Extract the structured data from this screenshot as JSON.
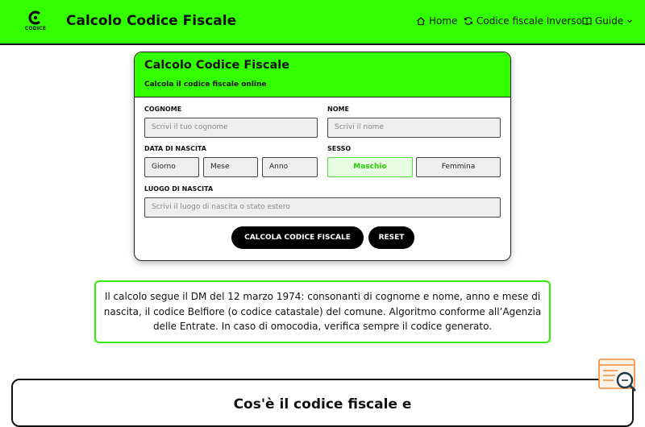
{
  "header": {
    "logo_text": "CODICE",
    "title": "Calcolo Codice Fiscale",
    "nav": [
      {
        "label": "Home",
        "icon": "home-icon"
      },
      {
        "label": "Codice fiscale Inverso",
        "icon": "refresh-icon"
      },
      {
        "label": "Guide",
        "icon": "book-icon"
      }
    ]
  },
  "form": {
    "title": "Calcolo Codice Fiscale",
    "subtitle": "Calcola il codice fiscale online",
    "cognome_label": "COGNOME",
    "cognome_placeholder": "Scrivi il tuo cognome",
    "nome_label": "NOME",
    "nome_placeholder": "Scrivi il nome",
    "nascita_label": "DATA DI NASCITA",
    "giorno": "Giorno",
    "mese": "Mese",
    "anno": "Anno",
    "sesso_label": "SESSO",
    "maschio": "Maschio",
    "femmina": "Femmina",
    "luogo_label": "LUOGO DI NASCITA",
    "luogo_placeholder": "Scrivi il luogo di nascita o stato estero",
    "calc_button": "CALCOLA CODICE FISCALE",
    "reset_button": "RESET"
  },
  "info": {
    "text": "Il calcolo segue il DM del 12 marzo 1974: consonanti di cognome e nome, anno e mese di nascita, il codice Belfiore (o codice catastale) del comune. Algoritmo conforme all’Agenzia delle Entrate. In caso di omocodia, verifica sempre il codice generato."
  },
  "bottom": {
    "title": "Cos'è il codice fiscale e"
  },
  "colors": {
    "accent": "#33ff00",
    "border": "#222222"
  }
}
